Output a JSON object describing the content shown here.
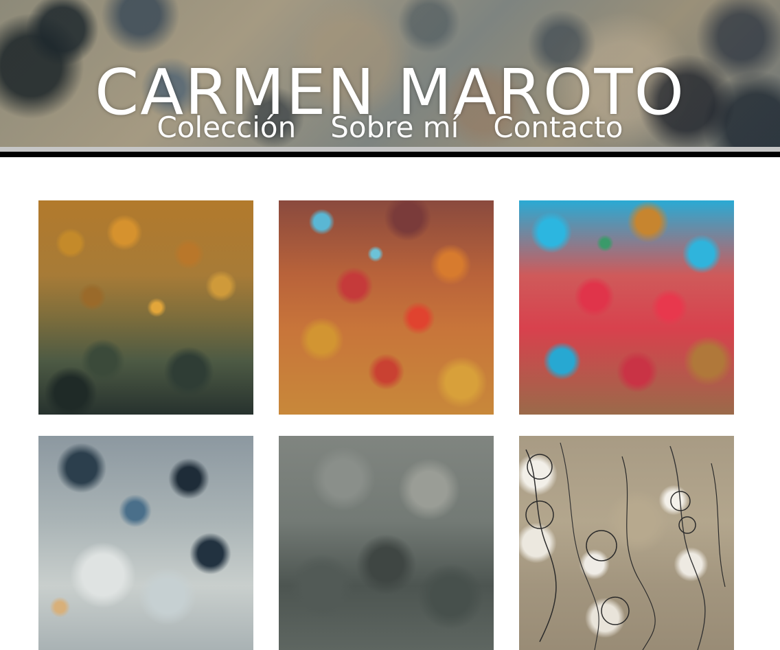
{
  "site": {
    "title": "CARMEN MAROTO"
  },
  "nav": {
    "items": [
      {
        "label": "Colección"
      },
      {
        "label": "Sobre mí"
      },
      {
        "label": "Contacto"
      }
    ]
  },
  "gallery": {
    "artworks": [
      {
        "palette": [
          "#c48a2a",
          "#4d5a44",
          "#27322e"
        ]
      },
      {
        "palette": [
          "#c53a3a",
          "#d29532",
          "#5ab7d4"
        ]
      },
      {
        "palette": [
          "#2cb6e0",
          "#e0344a",
          "#c7852f"
        ]
      },
      {
        "palette": [
          "#2c3f4d",
          "#dfe3e2",
          "#8c98a0"
        ]
      },
      {
        "palette": [
          "#808580",
          "#4d5551",
          "#9a9d96"
        ]
      },
      {
        "palette": [
          "#a89b84",
          "#f2efe8",
          "#2a2a2a"
        ]
      }
    ]
  },
  "colors": {
    "band_grey": "#c6c6c6",
    "band_black": "#000000",
    "page_background": "#ffffff",
    "header_text": "#ffffff"
  }
}
